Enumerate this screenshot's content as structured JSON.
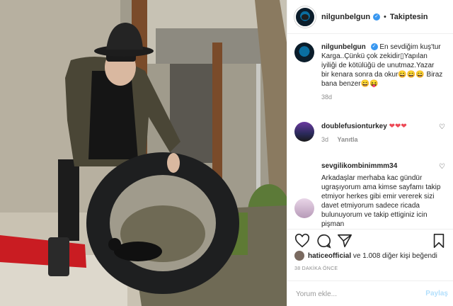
{
  "colors": {
    "accent": "#3897f0",
    "text": "#262626",
    "muted": "#8e8e8e",
    "share": "#b2dffc",
    "heart": "#ed4956"
  },
  "post": {
    "username": "nilgunbelgun",
    "follow_label": "Takiptesin",
    "dot": "•"
  },
  "caption": {
    "username": "nilgunbelgun",
    "text": "En sevdiğim kuş'tur Karga..Çünkü çok zekidir▯Yapılan iyiliği de kötülüğü de unutmaz.Yazar bir kenara sonra da okur😄😄😄 Biraz bana benzer😄😝",
    "age": "38d"
  },
  "comments": [
    {
      "username": "doublefusionturkey",
      "text": "❤❤❤",
      "age": "3d",
      "reply": "Yanıtla"
    },
    {
      "username": "sevgilikombinimmm34",
      "text": "Arkadaşlar merhaba kac gündür ugraşıyorum ama kimse sayfamı takip etmiyor herkes gibi emir vererek sizi davet etmiyorum sadece ricada bulunuyorum ve takip ettiginiz icin pişman"
    }
  ],
  "likes": {
    "user": "haticeofficial",
    "text": " ve 1.008 diğer kişi beğendi"
  },
  "timestamp": "38 DAKİKA ÖNCE",
  "add_comment": {
    "placeholder": "Yorum ekle...",
    "share_label": "Paylaş"
  },
  "icons": [
    "heart-icon",
    "comment-icon",
    "share-icon",
    "bookmark-icon",
    "more-options-icon"
  ]
}
